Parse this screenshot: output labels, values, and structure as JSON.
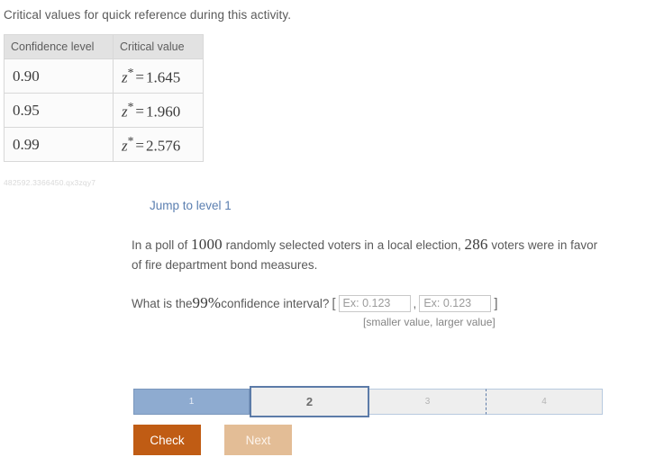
{
  "intro": {
    "text": "Critical values for quick reference during this activity."
  },
  "critical_table": {
    "headers": [
      "Confidence level",
      "Critical value"
    ],
    "rows": [
      {
        "level": "0.90",
        "symbol": "z",
        "star": "*",
        "equals": "=",
        "value": "1.645"
      },
      {
        "level": "0.95",
        "symbol": "z",
        "star": "*",
        "equals": "=",
        "value": "1.960"
      },
      {
        "level": "0.99",
        "symbol": "z",
        "star": "*",
        "equals": "=",
        "value": "2.576"
      }
    ]
  },
  "watermark": {
    "text": "482592.3366450.qx3zqy7"
  },
  "activity": {
    "jump_link": "Jump to level 1",
    "question": {
      "part1": "In a poll of ",
      "sample_size": "1000",
      "part2": " randomly selected voters in a local election, ",
      "favorable_count": "286",
      "part3": " voters were in favor of fire department bond measures."
    },
    "confidence_prompt": {
      "prefix": "What is the ",
      "confidence_level": "99%",
      "suffix": " confidence interval?",
      "open_bracket": "[",
      "close_bracket": "]",
      "separator": ",",
      "lower_placeholder": "Ex: 0.123",
      "upper_placeholder": "Ex: 0.123",
      "lower_value": "",
      "upper_value": "",
      "hint": "[smaller value, larger value]"
    }
  },
  "progress": {
    "segments": [
      {
        "label": "1",
        "state": "completed"
      },
      {
        "label": "2",
        "state": "current"
      },
      {
        "label": "3",
        "state": "upcoming"
      },
      {
        "label": "4",
        "state": "upcoming"
      }
    ]
  },
  "actions": {
    "check_label": "Check",
    "next_label": "Next"
  },
  "colors": {
    "link": "#5b7fb0",
    "progress_done": "#8eabd0",
    "progress_current_border": "#5c7ba8",
    "progress_idle": "#eeeeee",
    "check_button": "#c05c14",
    "next_button": "#e3bd96",
    "table_header": "#e2e2e2"
  }
}
